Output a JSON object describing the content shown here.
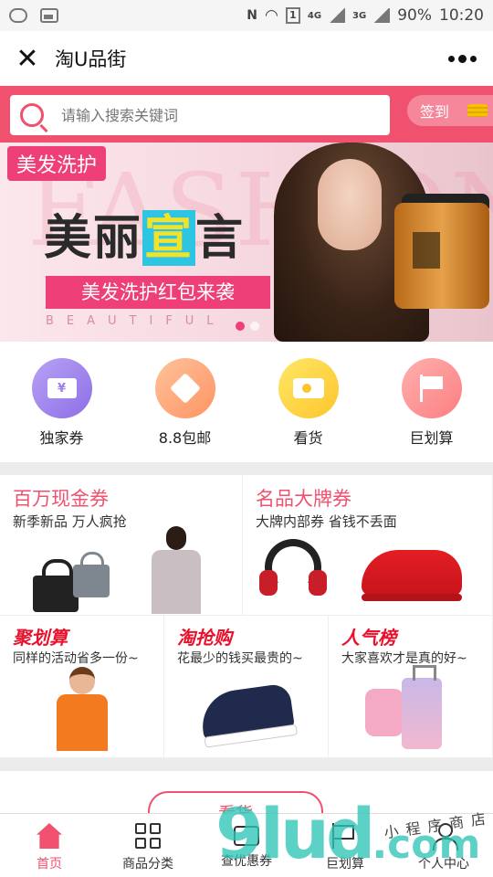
{
  "status_bar": {
    "network_4g": "4G",
    "network_3g": "3G",
    "sim_badge": "1",
    "battery": "90%",
    "time": "10:20"
  },
  "titlebar": {
    "title": "淘U品街"
  },
  "search": {
    "placeholder": "请输入搜索关键词",
    "checkin_label": "签到"
  },
  "banner": {
    "tag": "美发洗护",
    "bg_text": "FASHION",
    "headline_a": "美丽",
    "headline_hl": "宣",
    "headline_b": "言",
    "sub": "美发洗护红包来袭",
    "beauty": "BEAUTIFUL"
  },
  "categories": [
    {
      "label": "独家券",
      "icon": "ticket-icon"
    },
    {
      "label": "8.8包邮",
      "icon": "diamond-icon"
    },
    {
      "label": "看货",
      "icon": "video-icon"
    },
    {
      "label": "巨划算",
      "icon": "flag-icon"
    }
  ],
  "promos_top": [
    {
      "title": "百万现金券",
      "sub": "新季新品 万人疯抢"
    },
    {
      "title": "名品大牌券",
      "sub": "大牌内部券 省钱不丢面"
    }
  ],
  "promos_bottom": [
    {
      "title": "聚划算",
      "sub": "同样的活动省多一份~"
    },
    {
      "title": "淘抢购",
      "sub": "花最少的钱买最贵的~"
    },
    {
      "title": "人气榜",
      "sub": "大家喜欢才是真的好~"
    }
  ],
  "section": {
    "kanhuo_title": "看货"
  },
  "tabs": [
    {
      "label": "首页",
      "icon": "home-icon"
    },
    {
      "label": "商品分类",
      "icon": "grid-icon"
    },
    {
      "label": "查优惠券",
      "icon": "ticket-icon"
    },
    {
      "label": "巨划算",
      "icon": "flag-icon"
    },
    {
      "label": "个人中心",
      "icon": "person-icon"
    }
  ],
  "watermark": {
    "main": "9lud",
    "suffix": ".com",
    "small": "小程序商店"
  },
  "colors": {
    "brand": "#f0516f",
    "accent": "#ee3f78"
  }
}
